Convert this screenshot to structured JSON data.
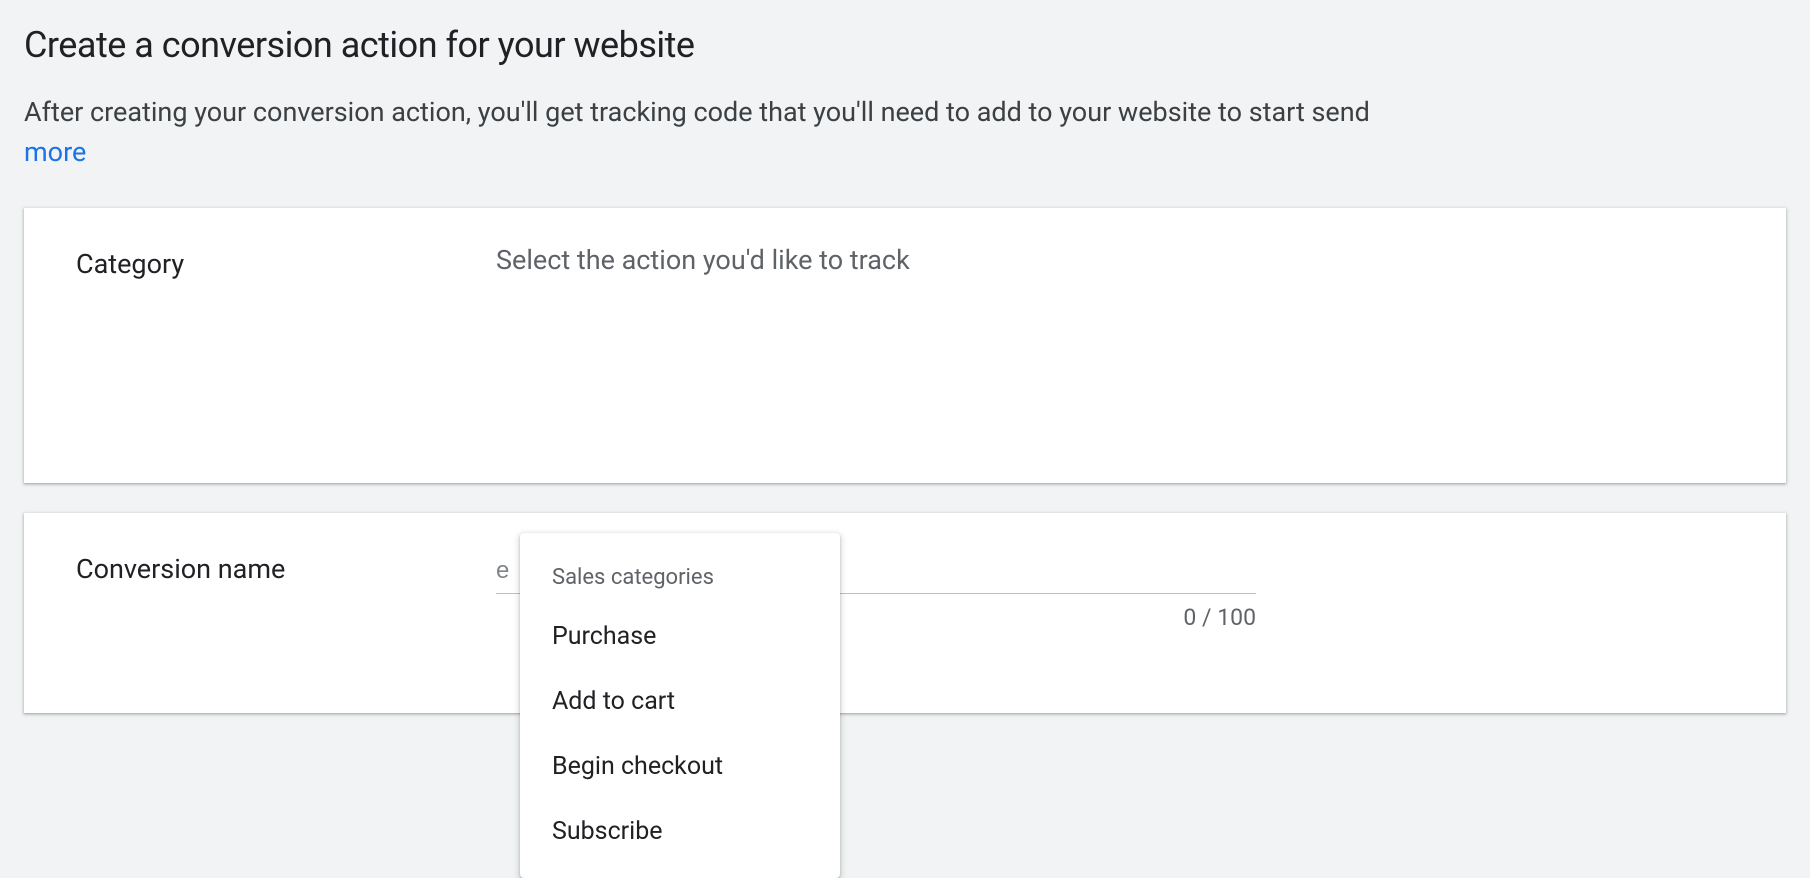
{
  "page": {
    "title": "Create a conversion action for your website",
    "description": "After creating your conversion action, you'll get tracking code that you'll need to add to your website to start send",
    "learn_more_label": "more"
  },
  "category_section": {
    "label": "Category",
    "hint": "Select the action you'd like to track"
  },
  "conversion_name_section": {
    "label": "Conversion name",
    "input_value": "",
    "input_placeholder_fragment": "e",
    "char_counter": "0 / 100"
  },
  "dropdown": {
    "group_label": "Sales categories",
    "items": [
      "Purchase",
      "Add to cart",
      "Begin checkout",
      "Subscribe"
    ]
  }
}
